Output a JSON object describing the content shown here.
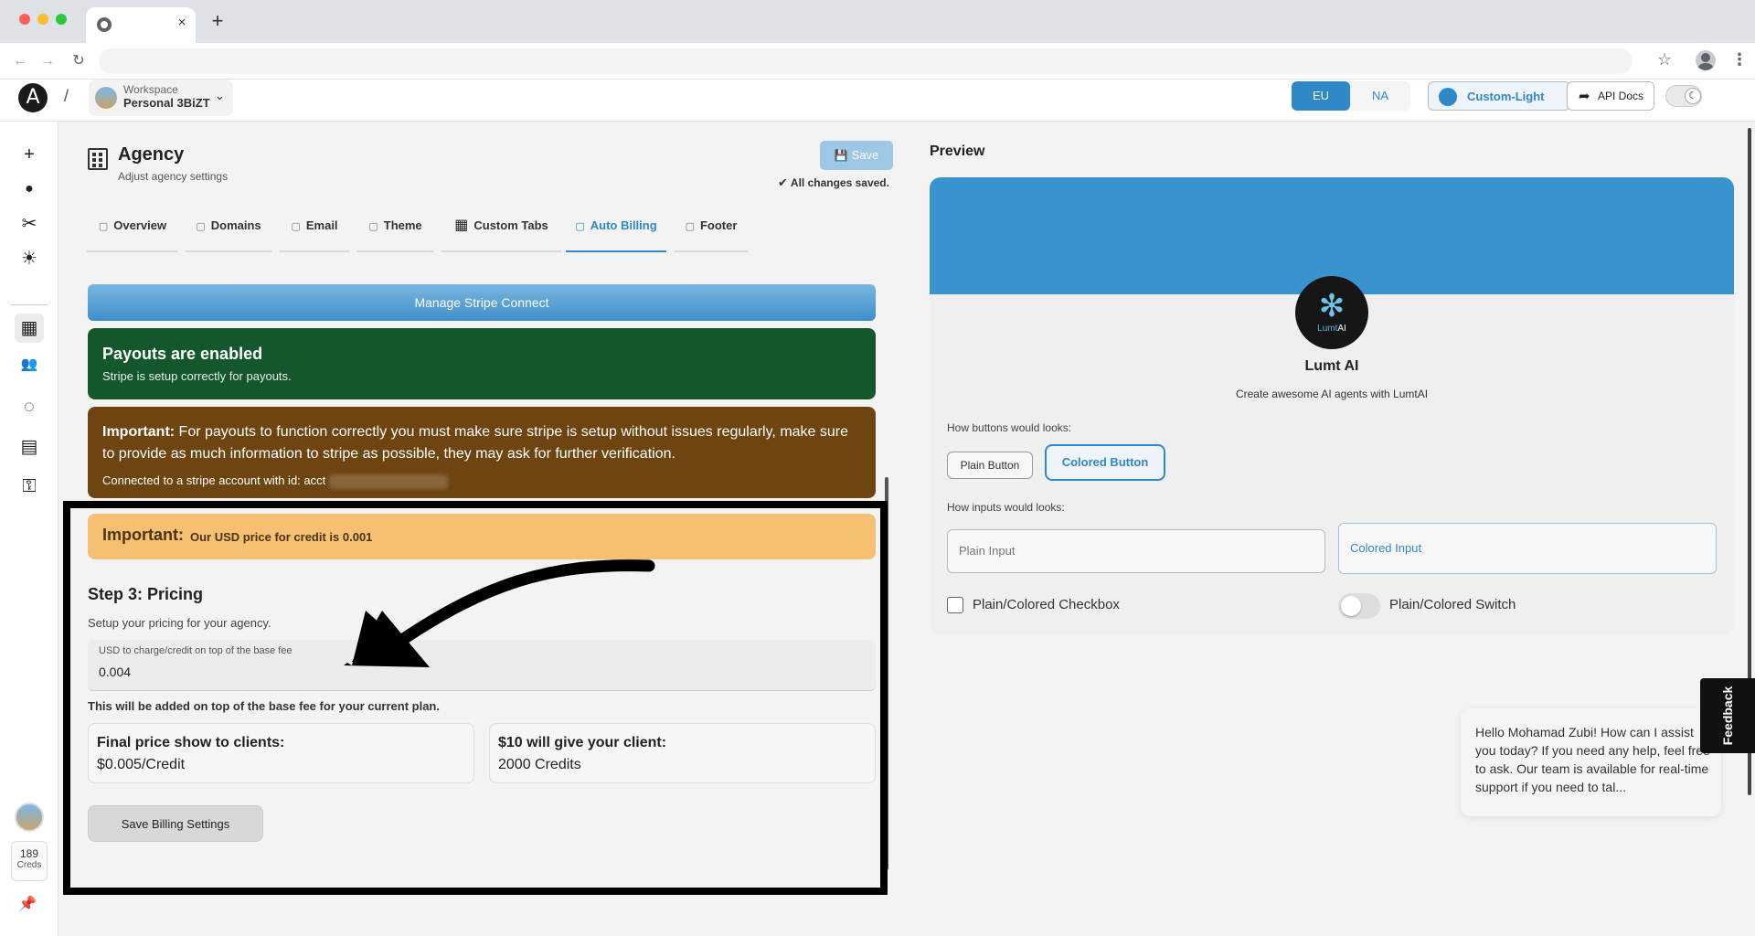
{
  "browser": {
    "close_tab": "×",
    "new_tab": "+",
    "back": "←",
    "forward": "→",
    "reload": "↻",
    "star": "☆",
    "menu": "⋮"
  },
  "header": {
    "logo": "A",
    "separator": "/",
    "workspace_label": "Workspace",
    "workspace_name": "Personal 3BiZT",
    "chevron": "⌄",
    "region_eu": "EU",
    "region_na": "NA",
    "theme_label": "Custom-Light",
    "api_icon": "➦",
    "api_label": "API Docs",
    "dark_icon": "☾"
  },
  "rail": {
    "items": [
      {
        "icon": "plus-icon",
        "glyph": "+"
      },
      {
        "icon": "bot-icon",
        "glyph": "●"
      },
      {
        "icon": "tools-icon",
        "glyph": "✂"
      },
      {
        "icon": "bug-icon",
        "glyph": "☀"
      },
      {
        "icon": "building-icon",
        "glyph": "▦"
      },
      {
        "icon": "users-icon",
        "glyph": "👥"
      },
      {
        "icon": "refresh-icon",
        "glyph": "◌"
      },
      {
        "icon": "server-icon",
        "glyph": "▤"
      },
      {
        "icon": "key-icon",
        "glyph": "⚿"
      }
    ],
    "creds_value": "189",
    "creds_label": "Creds",
    "pin": "📌"
  },
  "agency": {
    "title": "Agency",
    "subtitle": "Adjust agency settings",
    "save_icon": "💾",
    "save_label": "Save",
    "saved_check": "✔",
    "saved_note": "All changes saved."
  },
  "tabs": [
    {
      "label": "Overview",
      "icon": "doc-icon"
    },
    {
      "label": "Domains",
      "icon": "doc-icon"
    },
    {
      "label": "Email",
      "icon": "doc-icon"
    },
    {
      "label": "Theme",
      "icon": "doc-icon"
    },
    {
      "label": "Custom Tabs",
      "icon": "grid-icon"
    },
    {
      "label": "Auto Billing",
      "icon": "doc-icon",
      "active": true
    },
    {
      "label": "Footer",
      "icon": "doc-icon"
    }
  ],
  "billing": {
    "stripe_button": "Manage Stripe Connect",
    "payout_title": "Payouts are enabled",
    "payout_sub": "Stripe is setup correctly for payouts.",
    "warn_strong": "Important:",
    "warn_text": " For payouts to function correctly you must make sure stripe is setup without issues regularly, make sure to provide as much information to stripe as possible, they may ask for further verification.",
    "warn_acct": "Connected to a stripe account with id: acct",
    "price_strong": "Important:",
    "price_text": "Our USD price for credit is 0.001",
    "step_title": "Step 3: Pricing",
    "step_sub": "Setup your pricing for your agency.",
    "usd_label": "USD to charge/credit on top of the base fee",
    "usd_value": "0.004",
    "fee_note": "This will be added on top of the base fee for your current plan.",
    "final_label": "Final price show to clients:",
    "final_value": "$0.005/Credit",
    "ten_label": "$10 will give your client:",
    "ten_value": "2000 Credits",
    "save_billing": "Save Billing Settings"
  },
  "preview": {
    "title": "Preview",
    "logo_glyph": "✻",
    "logo_text_a": "Lumt",
    "logo_text_b": "AI",
    "name": "Lumt AI",
    "description": "Create awesome AI agents with LumtAI",
    "buttons_caption": "How buttons would looks:",
    "plain_button": "Plain Button",
    "colored_button": "Colored Button",
    "inputs_caption": "How inputs would looks:",
    "plain_input": "Plain Input",
    "colored_input": "Colored Input",
    "checkbox_label": "Plain/Colored Checkbox",
    "switch_label": "Plain/Colored Switch"
  },
  "feedback": "Feedback",
  "chat": {
    "message": "Hello Mohamad Zubi! How can I assist you today? If you need any help, feel free to ask. Our team is available for real-time support if you need to tal..."
  },
  "colors": {
    "accent": "#2f88c7",
    "payout_green": "#15572c",
    "warn_brown": "#6e4411",
    "price_orange": "#f5c072"
  }
}
